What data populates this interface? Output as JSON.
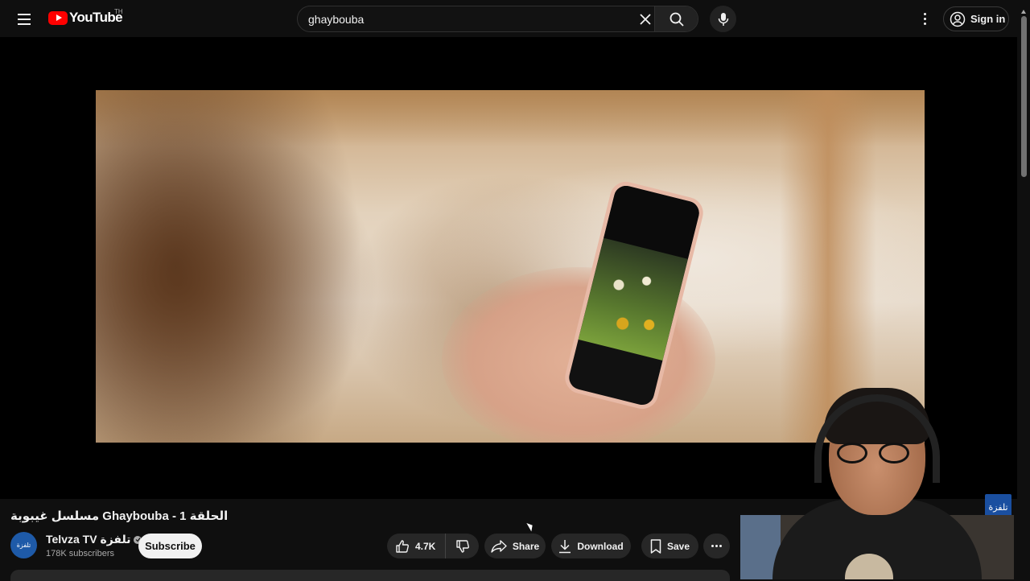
{
  "header": {
    "logo_text": "YouTube",
    "country_code": "TH",
    "search": {
      "value": "ghaybouba",
      "placeholder": "Search"
    },
    "sign_in_label": "Sign in"
  },
  "video": {
    "watermark_text": "تلفزة"
  },
  "meta": {
    "title": "مسلسل غيبوبة Ghaybouba - 1 الحلقة",
    "channel_name": "Telvza TV تلفزة",
    "channel_avatar_text": "تلفزة",
    "subscribers": "178K subscribers",
    "subscribe_label": "Subscribe",
    "actions": {
      "likes": "4.7K",
      "share_label": "Share",
      "download_label": "Download",
      "save_label": "Save"
    }
  },
  "colors": {
    "background": "#0f0f0f",
    "brand_red": "#ff0000",
    "pill_bg": "#272727",
    "subscribe_bg": "#f1f1f1"
  },
  "icons": [
    "menu-icon",
    "youtube-logo-icon",
    "close-icon",
    "search-icon",
    "mic-icon",
    "more-vert-icon",
    "account-circle-icon",
    "verified-icon",
    "thumb-up-icon",
    "thumb-down-icon",
    "share-icon",
    "download-icon",
    "bookmark-icon",
    "more-horiz-icon"
  ]
}
